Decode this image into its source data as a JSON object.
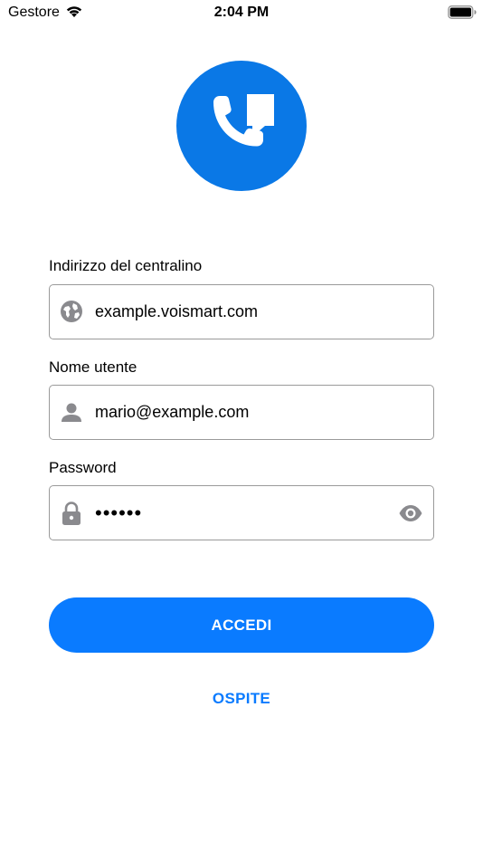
{
  "status_bar": {
    "carrier": "Gestore",
    "time": "2:04 PM",
    "icons": [
      "wifi-icon",
      "battery-icon"
    ]
  },
  "logo": {
    "icon": "phone-chat-icon",
    "color": "#0a78e6"
  },
  "form": {
    "server": {
      "label": "Indirizzo del centralino",
      "value": "example.voismart.com",
      "icon": "globe-icon"
    },
    "username": {
      "label": "Nome utente",
      "value": "mario@example.com",
      "icon": "person-icon"
    },
    "password": {
      "label": "Password",
      "value": "••••••",
      "icon": "lock-icon",
      "toggle_icon": "eye-icon"
    }
  },
  "actions": {
    "login_label": "ACCEDI",
    "guest_label": "OSPITE"
  },
  "colors": {
    "accent": "#0a7bff",
    "field_border": "#9a9a9a",
    "icon_gray": "#8a8a8e"
  }
}
